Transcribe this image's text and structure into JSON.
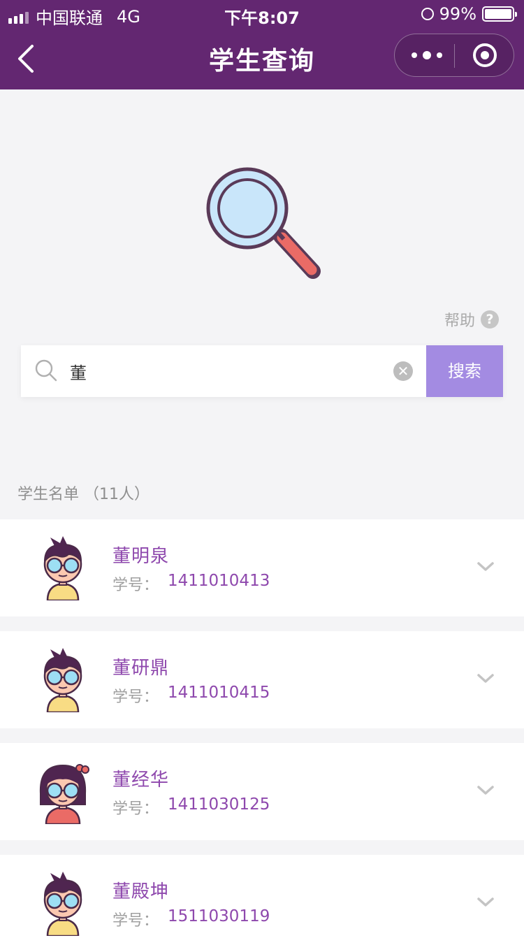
{
  "status_bar": {
    "carrier": "中国联通",
    "network": "4G",
    "time": "下午8:07",
    "battery": "99%"
  },
  "nav": {
    "title": "学生查询",
    "icons": [
      "back-icon",
      "more-icon",
      "target-icon"
    ]
  },
  "help": {
    "label": "帮助",
    "icon": "?"
  },
  "search": {
    "value": "董",
    "button_label": "搜索",
    "clear_icon": "✕"
  },
  "list": {
    "title": "学生名单 （11人）"
  },
  "students": [
    {
      "name": "董明泉",
      "id_label": "学号：",
      "id": "1411010413",
      "avatar": "boy-avatar"
    },
    {
      "name": "董研鼎",
      "id_label": "学号：",
      "id": "1411010415",
      "avatar": "boy-avatar"
    },
    {
      "name": "董经华",
      "id_label": "学号：",
      "id": "1411030125",
      "avatar": "girl-avatar"
    },
    {
      "name": "董殿坤",
      "id_label": "学号：",
      "id": "1511030119",
      "avatar": "boy-avatar"
    }
  ],
  "colors": {
    "header": "#632771",
    "accent": "#8e48ad",
    "search_button": "#a38be2",
    "background": "#f4f4f6"
  }
}
